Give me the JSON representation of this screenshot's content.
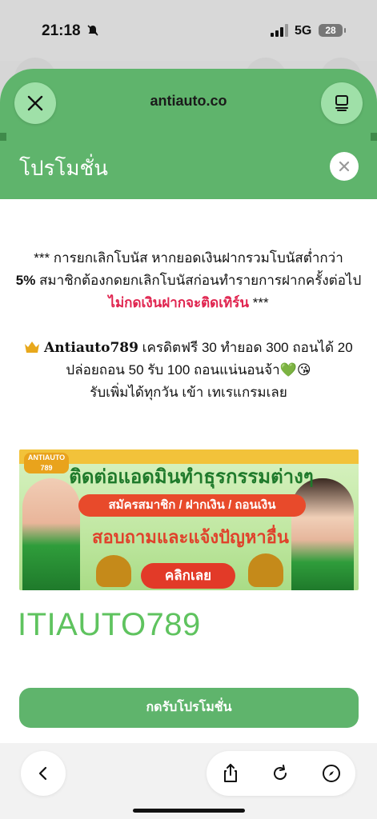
{
  "status_bar": {
    "time": "21:18",
    "network": "5G",
    "battery": "28"
  },
  "browser": {
    "url": "antiauto.co",
    "close_icon": "close-icon",
    "tabs_icon": "tabs-icon"
  },
  "modal": {
    "title": "โปรโมชั่น",
    "notice": {
      "part1": "*** การยกเลิกโบนัส หากยอดเงินฝากรวมโบนัสต่ำกว่า",
      "bold": "5%",
      "part2": " สมาชิกต้องกดยกเลิกโบนัสก่อนทำรายการฝากครั้งต่อไป ",
      "red": "ไม่กดเงินฝากจะติดเทิร์น",
      "part3": " ***"
    },
    "promo": {
      "brand": "Antiauto789",
      "line1_rest": " เครดิตฟรี 30 ทำยอด 300 ถอนได้ 20",
      "line2": "ปล่อยถอน 50 รับ 100 ถอนแน่นอนจ้า💚😘",
      "line3": "รับเพิ่มได้ทุกวัน เข้า เทเรแกรมเลย"
    },
    "banner": {
      "logo": "ANTIAUTO 789",
      "title": "ติดต่อแอดมินทำธุรกรรมต่างๆ",
      "pill": "สมัครสมาชิก / ฝากเงิน / ถอนเงิน",
      "subtitle": "สอบถามและแจ้งปัญหาอื่น",
      "button": "คลิกเลย"
    },
    "code": "ITIAUTO789",
    "claim_button": "กดรับโปรโมชั่น"
  },
  "toolbar": {
    "back": "chevron-left-icon",
    "share": "share-icon",
    "reload": "reload-icon",
    "compass": "compass-icon"
  },
  "colors": {
    "accent": "#5fb46c",
    "red": "#e0244f",
    "code": "#5fc35f"
  }
}
